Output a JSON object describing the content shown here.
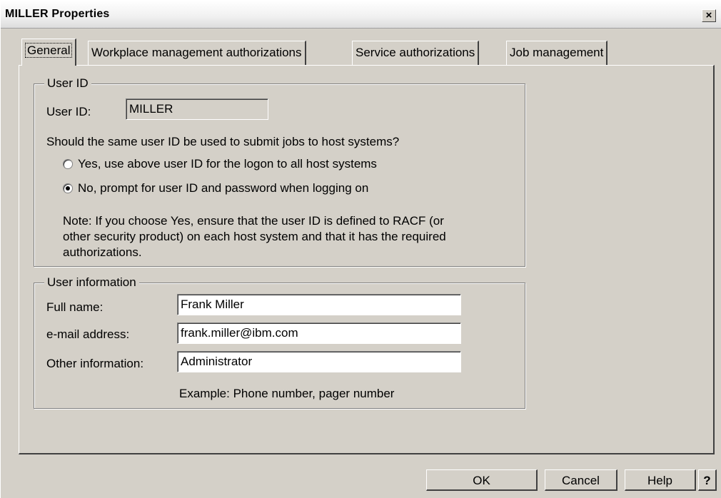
{
  "window": {
    "title": "MILLER Properties",
    "close_glyph": "×"
  },
  "tabs": [
    {
      "label": "General",
      "active": true
    },
    {
      "label": "Workplace management authorizations",
      "active": false
    },
    {
      "label": "Service authorizations",
      "active": false
    },
    {
      "label": "Job management",
      "active": false
    }
  ],
  "user_id_group": {
    "legend": "User ID",
    "user_id_label": "User ID:",
    "user_id_value": "MILLER",
    "question": "Should the same user ID be used to submit jobs to host systems?",
    "options": [
      {
        "label": "Yes, use above user ID for the logon to all host systems",
        "selected": false
      },
      {
        "label": "No, prompt for user ID and password when logging on",
        "selected": true
      }
    ],
    "note_lines": [
      "Note: If you choose Yes, ensure that the user ID is defined to RACF (or",
      "other security product) on each host system and that it has the required",
      "authorizations."
    ]
  },
  "user_info_group": {
    "legend": "User information",
    "full_name_label": "Full name:",
    "full_name_value": "Frank Miller",
    "email_label": "e-mail address:",
    "email_value": "frank.miller@ibm.com",
    "other_label": "Other information:",
    "other_value": "Administrator",
    "example_hint": "Example: Phone number, pager number"
  },
  "buttons": {
    "ok": "OK",
    "cancel": "Cancel",
    "help": "Help",
    "whats_this": "?"
  }
}
